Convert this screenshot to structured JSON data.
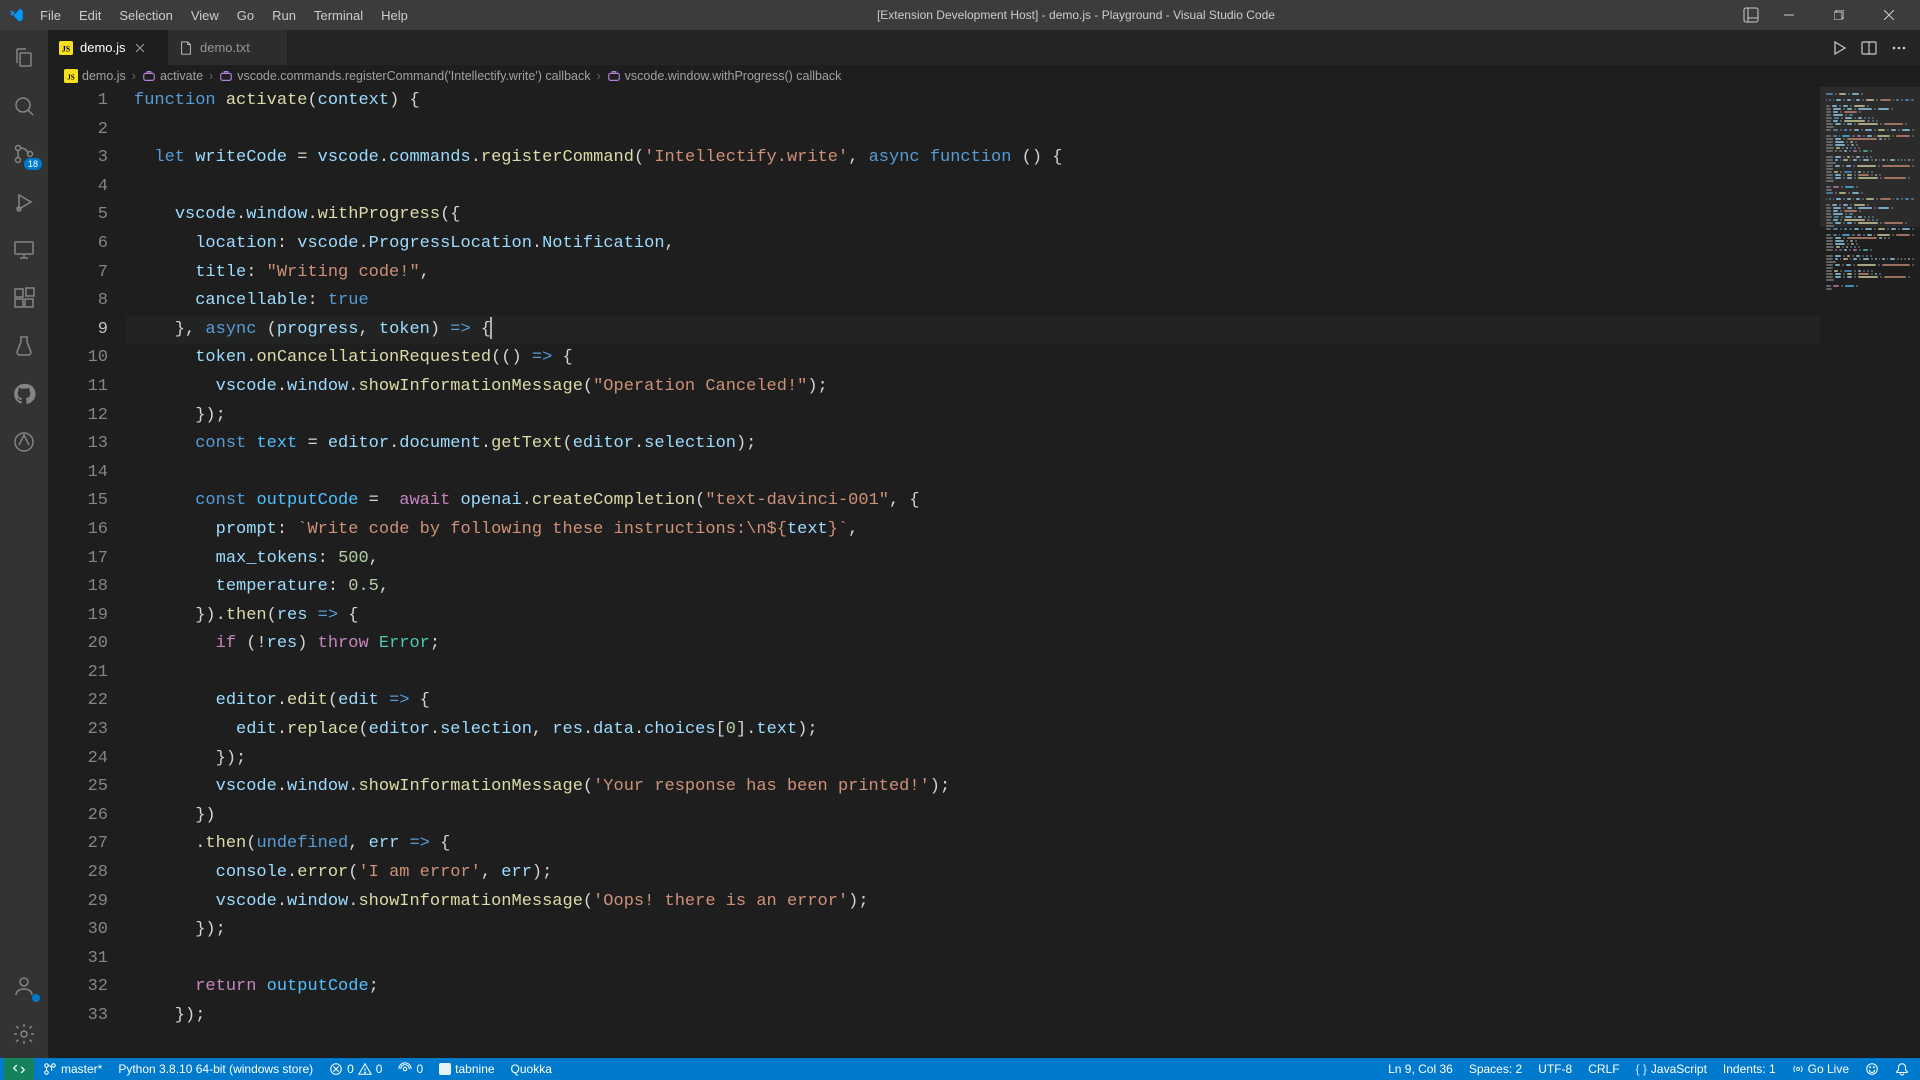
{
  "window": {
    "title": "[Extension Development Host] - demo.js - Playground - Visual Studio Code"
  },
  "menu": [
    "File",
    "Edit",
    "Selection",
    "View",
    "Go",
    "Run",
    "Terminal",
    "Help"
  ],
  "tabs": [
    {
      "label": "demo.js",
      "active": true
    },
    {
      "label": "demo.txt",
      "active": false
    }
  ],
  "activity_badge": "18",
  "breadcrumbs": {
    "items": [
      "demo.js",
      "activate",
      "vscode.commands.registerCommand('Intellectify.write') callback",
      "vscode.window.withProgress() callback"
    ]
  },
  "code": {
    "active_line": 9,
    "lines": [
      [
        [
          "kw",
          "function"
        ],
        [
          "pun",
          " "
        ],
        [
          "fn",
          "activate"
        ],
        [
          "pun",
          "("
        ],
        [
          "var",
          "context"
        ],
        [
          "pun",
          ") {"
        ]
      ],
      [],
      [
        [
          "pun",
          "  "
        ],
        [
          "kw",
          "let"
        ],
        [
          "pun",
          " "
        ],
        [
          "var",
          "writeCode"
        ],
        [
          "pun",
          " = "
        ],
        [
          "var",
          "vscode"
        ],
        [
          "pun",
          "."
        ],
        [
          "var",
          "commands"
        ],
        [
          "pun",
          "."
        ],
        [
          "fn",
          "registerCommand"
        ],
        [
          "pun",
          "("
        ],
        [
          "str",
          "'Intellectify.write'"
        ],
        [
          "pun",
          ", "
        ],
        [
          "kw",
          "async"
        ],
        [
          "pun",
          " "
        ],
        [
          "kw",
          "function"
        ],
        [
          "pun",
          " () {"
        ]
      ],
      [],
      [
        [
          "pun",
          "    "
        ],
        [
          "var",
          "vscode"
        ],
        [
          "pun",
          "."
        ],
        [
          "var",
          "window"
        ],
        [
          "pun",
          "."
        ],
        [
          "fn",
          "withProgress"
        ],
        [
          "pun",
          "({"
        ]
      ],
      [
        [
          "pun",
          "      "
        ],
        [
          "prop",
          "location"
        ],
        [
          "pun",
          ": "
        ],
        [
          "var",
          "vscode"
        ],
        [
          "pun",
          "."
        ],
        [
          "var",
          "ProgressLocation"
        ],
        [
          "pun",
          "."
        ],
        [
          "var",
          "Notification"
        ],
        [
          "pun",
          ","
        ]
      ],
      [
        [
          "pun",
          "      "
        ],
        [
          "prop",
          "title"
        ],
        [
          "pun",
          ": "
        ],
        [
          "str",
          "\"Writing code!\""
        ],
        [
          "pun",
          ","
        ]
      ],
      [
        [
          "pun",
          "      "
        ],
        [
          "prop",
          "cancellable"
        ],
        [
          "pun",
          ": "
        ],
        [
          "bool",
          "true"
        ]
      ],
      [
        [
          "pun",
          "    }, "
        ],
        [
          "kw",
          "async"
        ],
        [
          "pun",
          " ("
        ],
        [
          "var",
          "progress"
        ],
        [
          "pun",
          ", "
        ],
        [
          "var",
          "token"
        ],
        [
          "pun",
          ") "
        ],
        [
          "kw",
          "=>"
        ],
        [
          "pun",
          " {"
        ]
      ],
      [
        [
          "pun",
          "      "
        ],
        [
          "var",
          "token"
        ],
        [
          "pun",
          "."
        ],
        [
          "fn",
          "onCancellationRequested"
        ],
        [
          "pun",
          "(() "
        ],
        [
          "kw",
          "=>"
        ],
        [
          "pun",
          " {"
        ]
      ],
      [
        [
          "pun",
          "        "
        ],
        [
          "var",
          "vscode"
        ],
        [
          "pun",
          "."
        ],
        [
          "var",
          "window"
        ],
        [
          "pun",
          "."
        ],
        [
          "fn",
          "showInformationMessage"
        ],
        [
          "pun",
          "("
        ],
        [
          "str",
          "\"Operation Canceled!\""
        ],
        [
          "pun",
          ");"
        ]
      ],
      [
        [
          "pun",
          "      });"
        ]
      ],
      [
        [
          "pun",
          "      "
        ],
        [
          "kw",
          "const"
        ],
        [
          "pun",
          " "
        ],
        [
          "const",
          "text"
        ],
        [
          "pun",
          " = "
        ],
        [
          "var",
          "editor"
        ],
        [
          "pun",
          "."
        ],
        [
          "var",
          "document"
        ],
        [
          "pun",
          "."
        ],
        [
          "fn",
          "getText"
        ],
        [
          "pun",
          "("
        ],
        [
          "var",
          "editor"
        ],
        [
          "pun",
          "."
        ],
        [
          "var",
          "selection"
        ],
        [
          "pun",
          ");"
        ]
      ],
      [],
      [
        [
          "pun",
          "      "
        ],
        [
          "kw",
          "const"
        ],
        [
          "pun",
          " "
        ],
        [
          "const",
          "outputCode"
        ],
        [
          "pun",
          " =  "
        ],
        [
          "kw2",
          "await"
        ],
        [
          "pun",
          " "
        ],
        [
          "var",
          "openai"
        ],
        [
          "pun",
          "."
        ],
        [
          "fn",
          "createCompletion"
        ],
        [
          "pun",
          "("
        ],
        [
          "str",
          "\"text-davinci-001\""
        ],
        [
          "pun",
          ", {"
        ]
      ],
      [
        [
          "pun",
          "        "
        ],
        [
          "prop",
          "prompt"
        ],
        [
          "pun",
          ": "
        ],
        [
          "str",
          "`Write code by following these instructions:\\n${"
        ],
        [
          "var",
          "text"
        ],
        [
          "str",
          "}`"
        ],
        [
          "pun",
          ","
        ]
      ],
      [
        [
          "pun",
          "        "
        ],
        [
          "prop",
          "max_tokens"
        ],
        [
          "pun",
          ": "
        ],
        [
          "num",
          "500"
        ],
        [
          "pun",
          ","
        ]
      ],
      [
        [
          "pun",
          "        "
        ],
        [
          "prop",
          "temperature"
        ],
        [
          "pun",
          ": "
        ],
        [
          "num",
          "0.5"
        ],
        [
          "pun",
          ","
        ]
      ],
      [
        [
          "pun",
          "      })."
        ],
        [
          "fn",
          "then"
        ],
        [
          "pun",
          "("
        ],
        [
          "var",
          "res"
        ],
        [
          "pun",
          " "
        ],
        [
          "kw",
          "=>"
        ],
        [
          "pun",
          " {"
        ]
      ],
      [
        [
          "pun",
          "        "
        ],
        [
          "kw2",
          "if"
        ],
        [
          "pun",
          " (!"
        ],
        [
          "var",
          "res"
        ],
        [
          "pun",
          ") "
        ],
        [
          "kw2",
          "throw"
        ],
        [
          "pun",
          " "
        ],
        [
          "cls",
          "Error"
        ],
        [
          "pun",
          ";"
        ]
      ],
      [],
      [
        [
          "pun",
          "        "
        ],
        [
          "var",
          "editor"
        ],
        [
          "pun",
          "."
        ],
        [
          "fn",
          "edit"
        ],
        [
          "pun",
          "("
        ],
        [
          "var",
          "edit"
        ],
        [
          "pun",
          " "
        ],
        [
          "kw",
          "=>"
        ],
        [
          "pun",
          " {"
        ]
      ],
      [
        [
          "pun",
          "          "
        ],
        [
          "var",
          "edit"
        ],
        [
          "pun",
          "."
        ],
        [
          "fn",
          "replace"
        ],
        [
          "pun",
          "("
        ],
        [
          "var",
          "editor"
        ],
        [
          "pun",
          "."
        ],
        [
          "var",
          "selection"
        ],
        [
          "pun",
          ", "
        ],
        [
          "var",
          "res"
        ],
        [
          "pun",
          "."
        ],
        [
          "var",
          "data"
        ],
        [
          "pun",
          "."
        ],
        [
          "var",
          "choices"
        ],
        [
          "pun",
          "["
        ],
        [
          "num",
          "0"
        ],
        [
          "pun",
          "]."
        ],
        [
          "var",
          "text"
        ],
        [
          "pun",
          ");"
        ]
      ],
      [
        [
          "pun",
          "        });"
        ]
      ],
      [
        [
          "pun",
          "        "
        ],
        [
          "var",
          "vscode"
        ],
        [
          "pun",
          "."
        ],
        [
          "var",
          "window"
        ],
        [
          "pun",
          "."
        ],
        [
          "fn",
          "showInformationMessage"
        ],
        [
          "pun",
          "("
        ],
        [
          "str",
          "'Your response has been printed!'"
        ],
        [
          "pun",
          ");"
        ]
      ],
      [
        [
          "pun",
          "      })"
        ]
      ],
      [
        [
          "pun",
          "      ."
        ],
        [
          "fn",
          "then"
        ],
        [
          "pun",
          "("
        ],
        [
          "kw",
          "undefined"
        ],
        [
          "pun",
          ", "
        ],
        [
          "var",
          "err"
        ],
        [
          "pun",
          " "
        ],
        [
          "kw",
          "=>"
        ],
        [
          "pun",
          " {"
        ]
      ],
      [
        [
          "pun",
          "        "
        ],
        [
          "var",
          "console"
        ],
        [
          "pun",
          "."
        ],
        [
          "fn",
          "error"
        ],
        [
          "pun",
          "("
        ],
        [
          "str",
          "'I am error'"
        ],
        [
          "pun",
          ", "
        ],
        [
          "var",
          "err"
        ],
        [
          "pun",
          ");"
        ]
      ],
      [
        [
          "pun",
          "        "
        ],
        [
          "var",
          "vscode"
        ],
        [
          "pun",
          "."
        ],
        [
          "var",
          "window"
        ],
        [
          "pun",
          "."
        ],
        [
          "fn",
          "showInformationMessage"
        ],
        [
          "pun",
          "("
        ],
        [
          "str",
          "'Oops! there is an error'"
        ],
        [
          "pun",
          ");"
        ]
      ],
      [
        [
          "pun",
          "      });"
        ]
      ],
      [],
      [
        [
          "pun",
          "      "
        ],
        [
          "kw2",
          "return"
        ],
        [
          "pun",
          " "
        ],
        [
          "const",
          "outputCode"
        ],
        [
          "pun",
          ";"
        ]
      ],
      [
        [
          "pun",
          "    });"
        ]
      ]
    ]
  },
  "status": {
    "branch": "master*",
    "python": "Python 3.8.10 64-bit (windows store)",
    "errors": "0",
    "warnings": "0",
    "ports": "0",
    "tabnine": "tabnine",
    "quokka": "Quokka",
    "lncol": "Ln 9, Col 36",
    "spaces": "Spaces: 2",
    "encoding": "UTF-8",
    "eol": "CRLF",
    "language": "JavaScript",
    "indents": "Indents: 1",
    "golive": "Go Live"
  }
}
